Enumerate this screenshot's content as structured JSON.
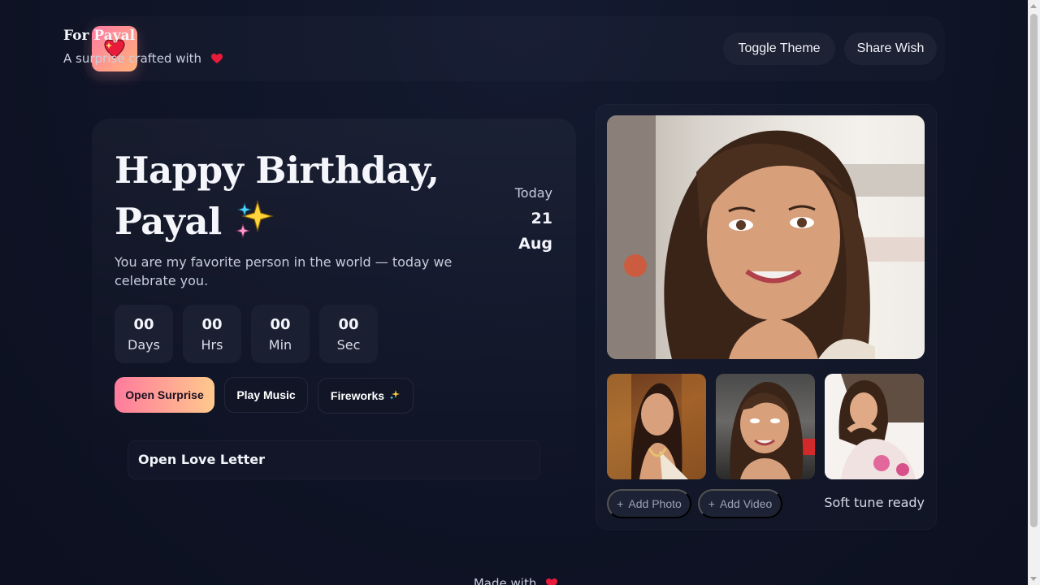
{
  "header": {
    "title": "For Payal",
    "subtitle": "A surprise crafted with",
    "buttons": {
      "toggle_theme": "Toggle Theme",
      "share_wish": "Share Wish"
    }
  },
  "hero": {
    "title_line1": "Happy Birthday,",
    "title_line2": "Payal",
    "subtitle": "You are my favorite person in the world — today we celebrate you.",
    "today": {
      "label": "Today",
      "day": "21",
      "month": "Aug"
    },
    "countdown": [
      {
        "value": "00",
        "unit": "Days"
      },
      {
        "value": "00",
        "unit": "Hrs"
      },
      {
        "value": "00",
        "unit": "Min"
      },
      {
        "value": "00",
        "unit": "Sec"
      }
    ],
    "actions": {
      "open_surprise": "Open Surprise",
      "play_music": "Play Music",
      "fireworks": "Fireworks"
    },
    "love_letter": "Open Love Letter"
  },
  "gallery": {
    "add_photo": "Add Photo",
    "add_video": "Add Video",
    "status": "Soft tune ready"
  },
  "footer": {
    "text": "Made with"
  },
  "icons": {
    "logo": "heart-sparkle-icon",
    "heart": "heart-icon",
    "sparkle": "sparkles-icon",
    "plus": "plus-icon"
  },
  "colors": {
    "accent_start": "#ff7b9c",
    "accent_end": "#ffc98d",
    "heart": "#e81b3b",
    "background": "#0f1426"
  }
}
